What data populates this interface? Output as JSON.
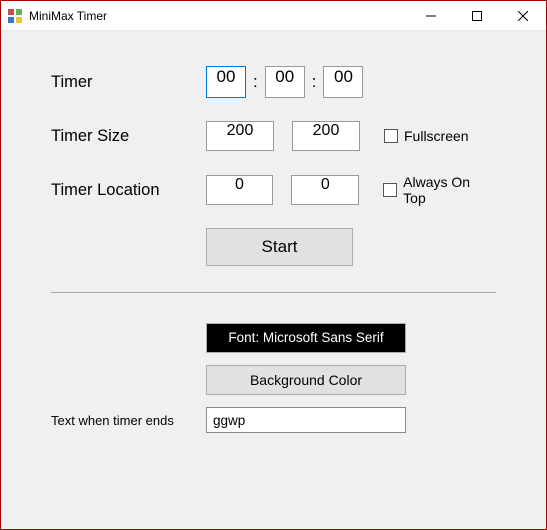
{
  "window": {
    "title": "MiniMax Timer"
  },
  "timer": {
    "label": "Timer",
    "hours": "00",
    "minutes": "00",
    "seconds": "00"
  },
  "size": {
    "label": "Timer Size",
    "width": "200",
    "height": "200",
    "fullscreen_label": "Fullscreen",
    "fullscreen_checked": false
  },
  "location": {
    "label": "Timer Location",
    "x": "0",
    "y": "0",
    "always_on_top_label": "Always On Top",
    "always_on_top_checked": false
  },
  "actions": {
    "start_label": "Start"
  },
  "font": {
    "button_label": "Font: Microsoft Sans Serif"
  },
  "background": {
    "button_label": "Background Color"
  },
  "end_text": {
    "label": "Text when timer ends",
    "value": "ggwp"
  }
}
